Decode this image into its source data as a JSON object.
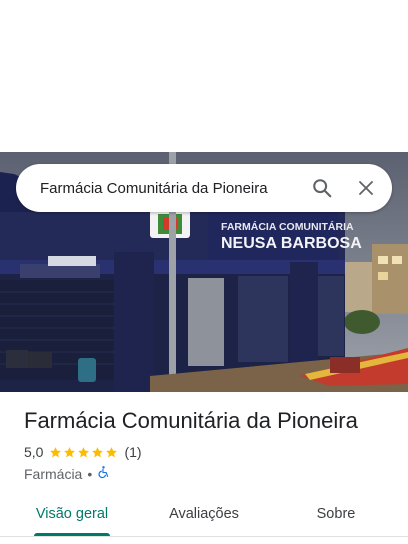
{
  "search": {
    "query": "Farmácia Comunitária da Pioneira",
    "search_icon": "search-icon",
    "close_icon": "close-icon"
  },
  "photo": {
    "sign_line1": "FARMÁCIA COMUNITÁRIA",
    "sign_line2": "NEUSA BARBOSA"
  },
  "place": {
    "name": "Farmácia Comunitária da Pioneira",
    "rating": "5,0",
    "stars": 5,
    "review_count": "(1)",
    "category": "Farmácia",
    "separator": "•",
    "accessibility_icon": "wheelchair-icon"
  },
  "tabs": [
    {
      "label": "Visão geral",
      "active": true
    },
    {
      "label": "Avaliações",
      "active": false
    },
    {
      "label": "Sobre",
      "active": false
    }
  ],
  "colors": {
    "accent": "#00796b",
    "star": "#fbbc04",
    "accessibility": "#1a73e8",
    "building": "#232a58"
  }
}
